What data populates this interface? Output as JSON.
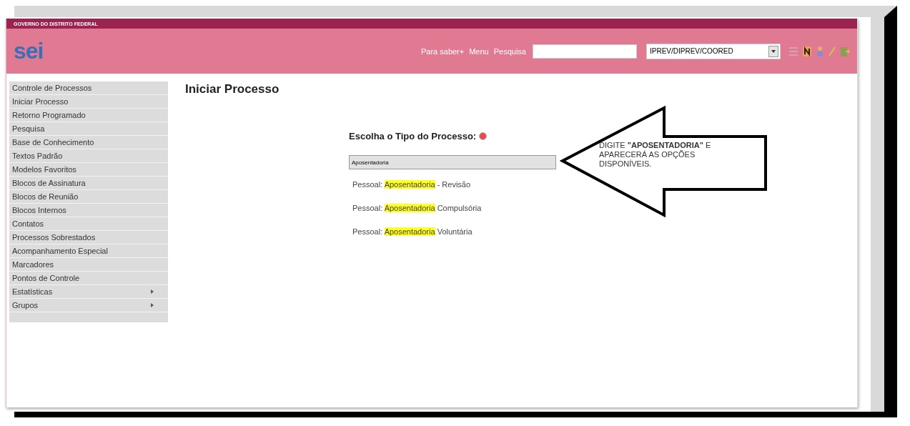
{
  "header": {
    "government": "GOVERNO DO DISTRITO FEDERAL",
    "logo": "sei",
    "links": [
      "Para saber+",
      "Menu",
      "Pesquisa"
    ],
    "unit_select": {
      "value": "IPREV/DIPREV/COORED"
    }
  },
  "sidebar": {
    "items": [
      {
        "label": "Controle de Processos",
        "has_submenu": false
      },
      {
        "label": "Iniciar Processo",
        "has_submenu": false
      },
      {
        "label": "Retorno Programado",
        "has_submenu": false
      },
      {
        "label": "Pesquisa",
        "has_submenu": false
      },
      {
        "label": "Base de Conhecimento",
        "has_submenu": false
      },
      {
        "label": "Textos Padrão",
        "has_submenu": false
      },
      {
        "label": "Modelos Favoritos",
        "has_submenu": false
      },
      {
        "label": "Blocos de Assinatura",
        "has_submenu": false
      },
      {
        "label": "Blocos de Reunião",
        "has_submenu": false
      },
      {
        "label": "Blocos Internos",
        "has_submenu": false
      },
      {
        "label": "Contatos",
        "has_submenu": false
      },
      {
        "label": "Processos Sobrestados",
        "has_submenu": false
      },
      {
        "label": "Acompanhamento Especial",
        "has_submenu": false
      },
      {
        "label": "Marcadores",
        "has_submenu": false
      },
      {
        "label": "Pontos de Controle",
        "has_submenu": false
      },
      {
        "label": "Estatísticas",
        "has_submenu": true
      },
      {
        "label": "Grupos",
        "has_submenu": true
      }
    ]
  },
  "page_title": "Iniciar Processo",
  "form": {
    "label": "Escolha o Tipo do Processo:",
    "input": {
      "value": "Aposentadoria"
    },
    "suggestions": [
      {
        "prefix": "Pessoal:",
        "match": "Aposentadoria",
        "suffix": "- Revisão"
      },
      {
        "prefix": "Pessoal:",
        "match": "Aposentadoria",
        "suffix": "Compulsória"
      },
      {
        "prefix": "Pessoal:",
        "match": "Aposentadoria",
        "suffix": "Voluntária"
      }
    ]
  },
  "callout": {
    "text": "DIGITE **\"APOSENTADORIA\"** E APARECERÁ AS OPÇÕES DISPONÍVEIS."
  }
}
